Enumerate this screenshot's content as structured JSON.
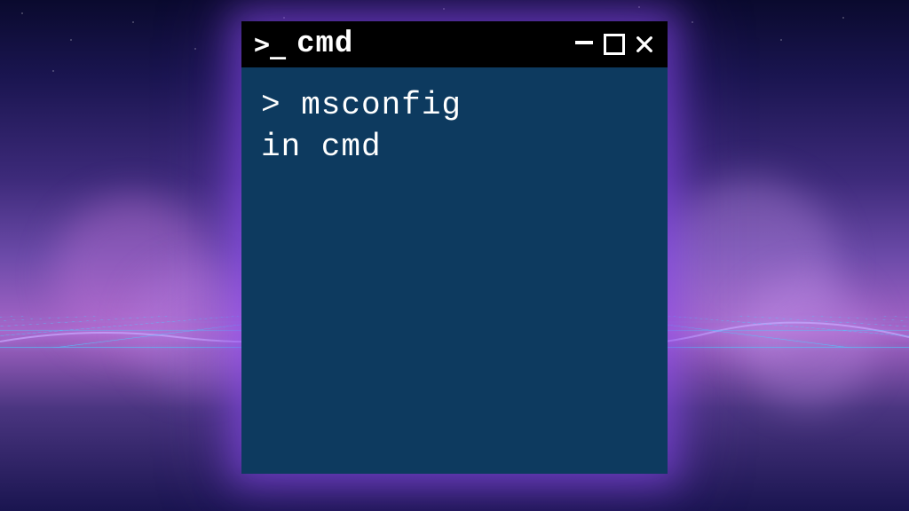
{
  "window": {
    "title": "cmd",
    "icon_name": "terminal-prompt-icon"
  },
  "terminal": {
    "prompt": ">",
    "line1": "> msconfig",
    "line2": "in cmd"
  },
  "colors": {
    "titlebar_bg": "#000000",
    "terminal_bg": "#0d3a5f",
    "text": "#ffffff",
    "glow": "#9650ff"
  }
}
